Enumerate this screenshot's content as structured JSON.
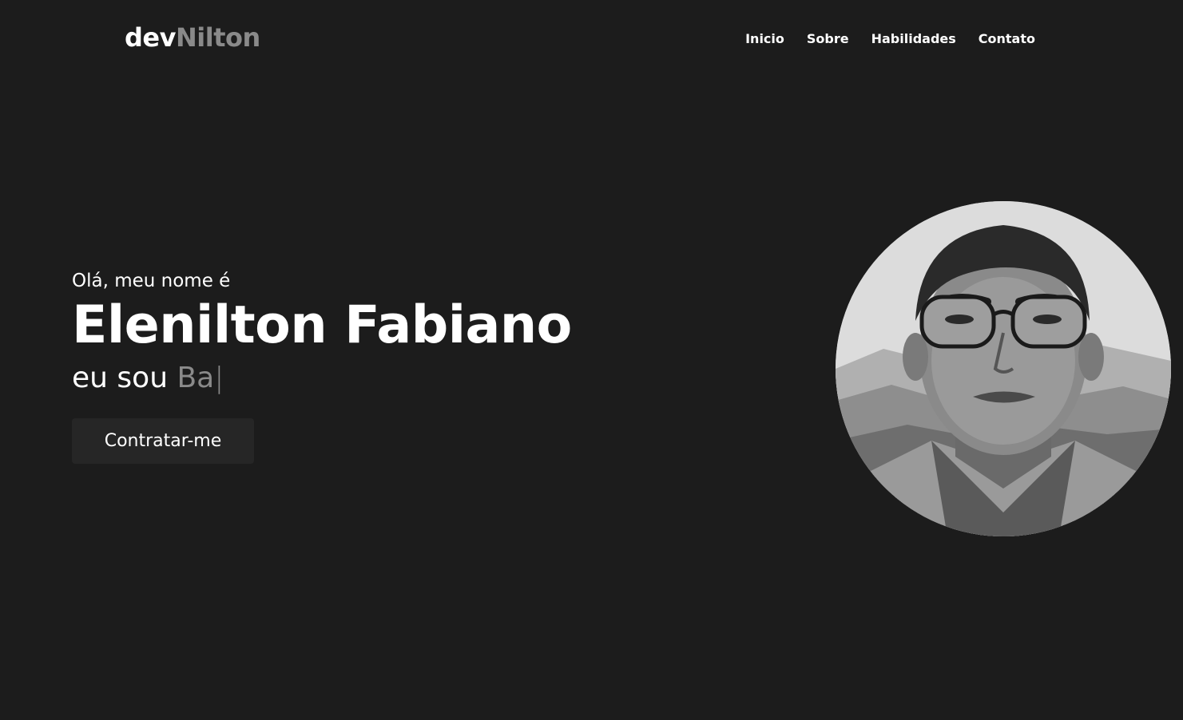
{
  "header": {
    "logo_primary": "dev",
    "logo_secondary": "Nilton",
    "nav": [
      {
        "label": "Inicio"
      },
      {
        "label": "Sobre"
      },
      {
        "label": "Habilidades"
      },
      {
        "label": "Contato"
      }
    ]
  },
  "hero": {
    "greeting": "Olá, meu nome é",
    "name": "Elenilton Fabiano",
    "role_prefix": "eu sou ",
    "role_typed": "Ba",
    "cursor": "|",
    "cta_label": "Contratar-me"
  },
  "colors": {
    "background": "#1c1c1c",
    "accent_gray": "#8a8a8a",
    "button_bg": "#262626"
  },
  "avatar": {
    "description_icon": "profile-portrait"
  }
}
